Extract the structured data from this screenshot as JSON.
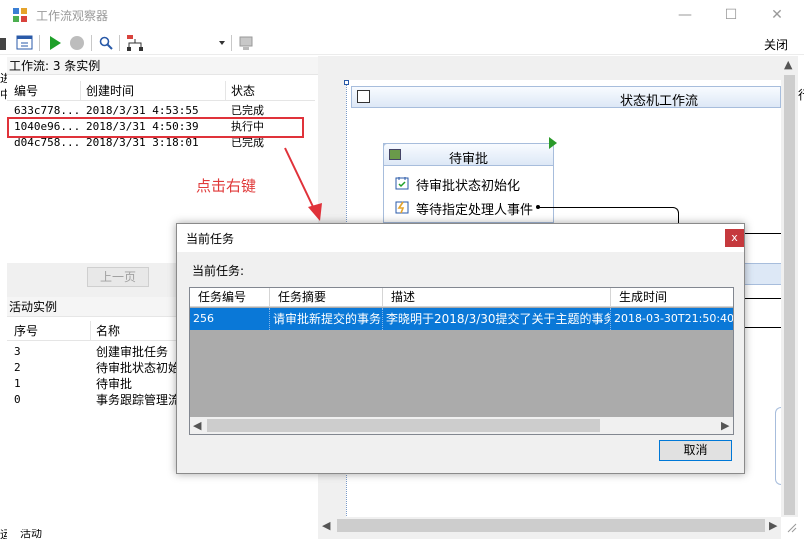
{
  "window": {
    "title": "工作流观察器",
    "close_label": "关闭",
    "min_glyph": "—",
    "max_glyph": "☐",
    "close_glyph": "✕"
  },
  "left_edge": {
    "char_1": "进",
    "char_2": "中",
    "char_3": "运"
  },
  "right_edge": {
    "char": "行"
  },
  "workflow_list": {
    "header": "工作流: 3 条实例",
    "columns": [
      "编号",
      "创建时间",
      "状态"
    ],
    "rows": [
      {
        "id": "633c778...",
        "created": "2018/3/31  4:53:55",
        "status": "已完成"
      },
      {
        "id": "1040e96...",
        "created": "2018/3/31  4:50:39",
        "status": "执行中"
      },
      {
        "id": "d04c758...",
        "created": "2018/3/31  3:18:01",
        "status": "已完成"
      }
    ],
    "prev_button": "上一页"
  },
  "activity_list": {
    "header": "活动实例",
    "columns": [
      "序号",
      "名称"
    ],
    "rows": [
      {
        "seq": "3",
        "name": "创建审批任务"
      },
      {
        "seq": "2",
        "name": "待审批状态初始"
      },
      {
        "seq": "1",
        "name": "待审批"
      },
      {
        "seq": "0",
        "name": "事务跟踪管理流"
      }
    ],
    "bottom_text": "活动"
  },
  "designer": {
    "state_machine_title": "状态机工作流",
    "state_title": "待审批",
    "activities": [
      "待审批状态初始化",
      "等待指定处理人事件"
    ]
  },
  "annotation": {
    "hint": "点击右键",
    "highlight_color": "#e0323a"
  },
  "dialog": {
    "title": "当前任务",
    "close_glyph": "x",
    "label": "当前任务:",
    "columns": [
      "任务编号",
      "任务摘要",
      "描述",
      "生成时间"
    ],
    "rows": [
      {
        "task_id": "256",
        "summary": "请审批新提交的事务",
        "description": "李晓明于2018/3/30提交了关于主题的事务",
        "created": "2018-03-30T21:50:40"
      }
    ],
    "cancel_button": "取消",
    "selection_color": "#0a78d7"
  }
}
